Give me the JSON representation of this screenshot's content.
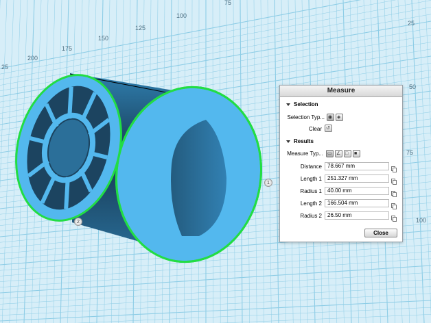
{
  "ruler": {
    "top_ticks": [
      "25",
      "200",
      "175",
      "150",
      "125",
      "100",
      "75"
    ],
    "right_ticks": [
      "25",
      "50",
      "75",
      "100"
    ]
  },
  "measure_panel": {
    "title": "Measure",
    "selection": {
      "header": "Selection",
      "type_label": "Selection Typ...",
      "clear_label": "Clear",
      "type_icons": [
        "vertex-select-icon",
        "face-select-icon"
      ]
    },
    "results": {
      "header": "Results",
      "type_label": "Measure Typ...",
      "type_icons": [
        "distance-icon",
        "angle-icon",
        "area-icon",
        "volume-icon"
      ],
      "fields": [
        {
          "label": "Distance",
          "value": "78.667 mm"
        },
        {
          "label": "Length 1",
          "value": "251.327 mm"
        },
        {
          "label": "Radius 1",
          "value": "40.00 mm"
        },
        {
          "label": "Length 2",
          "value": "166.504 mm"
        },
        {
          "label": "Radius 2",
          "value": "26.50 mm"
        }
      ]
    },
    "close_label": "Close"
  },
  "points": {
    "p1": "1",
    "p2": "2"
  },
  "colors": {
    "grid_bg": "#d7eef8",
    "grid_line": "#8ecde6",
    "part_blue": "#53b8ee",
    "part_dark": "#1f5577",
    "highlight": "#22dd44"
  }
}
